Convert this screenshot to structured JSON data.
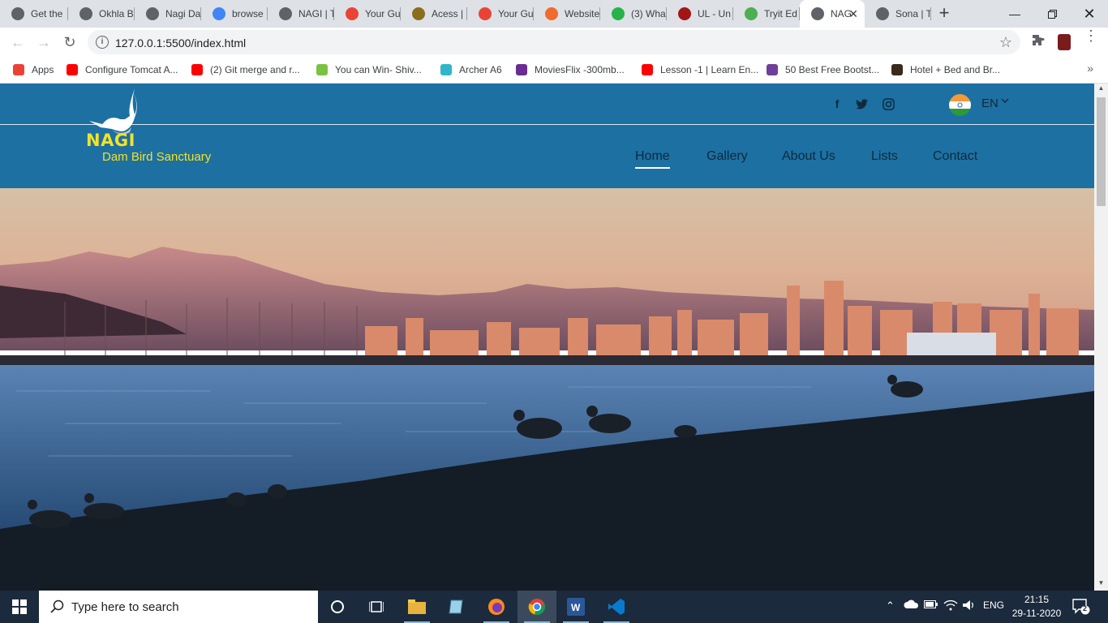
{
  "browser": {
    "tabs": [
      {
        "label": "Get the",
        "favicon": "bird-icon",
        "color": "#5f6368"
      },
      {
        "label": "Okhla B",
        "favicon": "globe-icon",
        "color": "#5f6368"
      },
      {
        "label": "Nagi Da",
        "favicon": "globe-icon",
        "color": "#5f6368"
      },
      {
        "label": "browse",
        "favicon": "google-icon",
        "color": "#4285f4"
      },
      {
        "label": "NAGI | T",
        "favicon": "globe-icon",
        "color": "#5f6368"
      },
      {
        "label": "Your Gu",
        "favicon": "gmail-icon",
        "color": "#ea4335"
      },
      {
        "label": "Acess |",
        "favicon": "app-icon",
        "color": "#8a6d1f"
      },
      {
        "label": "Your Gu",
        "favicon": "gmail-icon",
        "color": "#ea4335"
      },
      {
        "label": "Website",
        "favicon": "g-icon",
        "color": "#f06b2d"
      },
      {
        "label": "(3) Wha",
        "favicon": "whatsapp-icon",
        "color": "#25b34a"
      },
      {
        "label": "UL - Un",
        "favicon": "wdg-icon",
        "color": "#a31515"
      },
      {
        "label": "Tryit Ed",
        "favicon": "w3-icon",
        "color": "#4caf50"
      },
      {
        "label": "NAG",
        "favicon": "globe-icon",
        "color": "#5f6368",
        "active": true
      },
      {
        "label": "Sona | T",
        "favicon": "globe-icon",
        "color": "#5f6368"
      }
    ],
    "address": "127.0.0.1:5500/index.html",
    "bookmarks": [
      {
        "label": "Apps",
        "icon": "apps-grid-icon",
        "color": "#ea4335"
      },
      {
        "label": "Configure Tomcat A...",
        "icon": "youtube-icon",
        "color": "#ff0000"
      },
      {
        "label": "(2) Git merge and r...",
        "icon": "youtube-icon",
        "color": "#ff0000"
      },
      {
        "label": "You can Win- Shiv...",
        "icon": "book-icon",
        "color": "#7cc242"
      },
      {
        "label": "Archer A6",
        "icon": "tplink-icon",
        "color": "#30b6c8"
      },
      {
        "label": "MoviesFlix -300mb...",
        "icon": "moviesflix-icon",
        "color": "#6a2c91"
      },
      {
        "label": "Lesson -1 | Learn En...",
        "icon": "youtube-icon",
        "color": "#ff0000"
      },
      {
        "label": "50 Best Free Bootst...",
        "icon": "colorlib-icon",
        "color": "#6f3f9a"
      },
      {
        "label": "Hotel + Bed and Br...",
        "icon": "hotel-icon",
        "color": "#3a2a1a"
      }
    ]
  },
  "site": {
    "brand": {
      "title": "NAGI",
      "subtitle": "Dam Bird Sanctuary"
    },
    "language": "EN",
    "nav": [
      "Home",
      "Gallery",
      "About Us",
      "Lists",
      "Contact"
    ],
    "active_nav": "Home",
    "colors": {
      "header": "#1d70a2",
      "brand_text": "#f2e22a",
      "nav_text": "#0e2a3c"
    }
  },
  "taskbar": {
    "search_placeholder": "Type here to search",
    "language": "ENG",
    "time": "21:15",
    "date": "29-11-2020",
    "notifications": "2"
  }
}
